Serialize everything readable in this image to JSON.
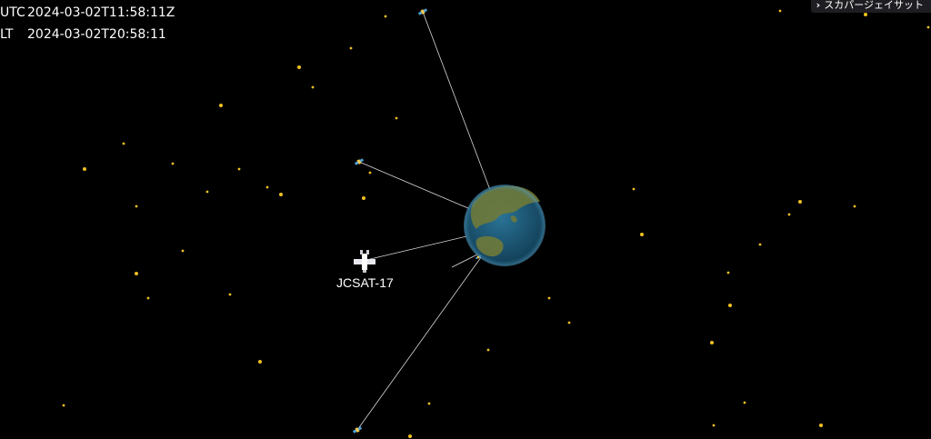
{
  "clock": {
    "utc_tag": "UTC",
    "utc_time": "2024-03-02T11:58:11Z",
    "lt_tag": "LT",
    "lt_time": "2024-03-02T20:58:11"
  },
  "top_button": {
    "icon": "chevron-right-icon",
    "label": "スカパージェイサット"
  },
  "selected_satellite": {
    "name": "JCSAT-17"
  },
  "colors": {
    "background": "#000000",
    "star": "#f0c020",
    "earth_ocean": "#1f5b78",
    "earth_land": "#6f7a3a",
    "link_line": "#d8d8d8"
  }
}
